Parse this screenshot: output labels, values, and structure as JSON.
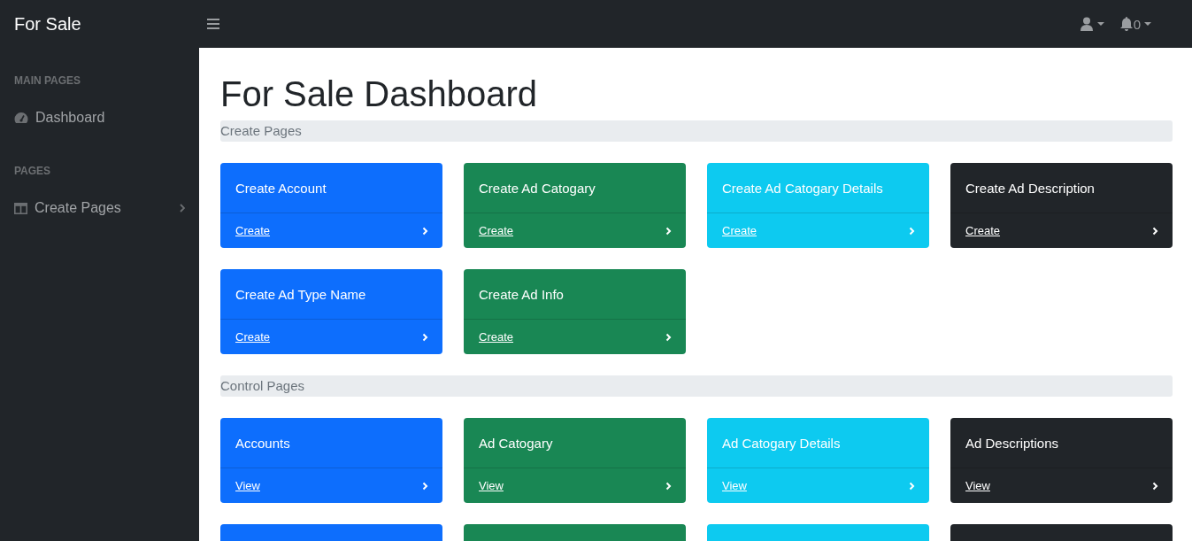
{
  "topbar": {
    "brand": "For Sale",
    "notification_count": "0"
  },
  "sidebar": {
    "sections": [
      {
        "heading": "MAIN PAGES",
        "items": [
          {
            "label": "Dashboard",
            "kind": "gauge",
            "expandable": false
          }
        ]
      },
      {
        "heading": "PAGES",
        "items": [
          {
            "label": "Create Pages",
            "kind": "columns",
            "expandable": true
          }
        ]
      }
    ]
  },
  "main": {
    "title": "For Sale Dashboard",
    "sections": [
      {
        "heading": "Create Pages",
        "cards": [
          {
            "title": "Create Account",
            "link": "Create",
            "color": "#0d6efd"
          },
          {
            "title": "Create Ad Catogary",
            "link": "Create",
            "color": "#198754"
          },
          {
            "title": "Create Ad Catogary Details",
            "link": "Create",
            "color": "#0dcaf0"
          },
          {
            "title": "Create Ad Description",
            "link": "Create",
            "color": "#212529"
          },
          {
            "title": "Create Ad Type Name",
            "link": "Create",
            "color": "#0d6efd"
          },
          {
            "title": "Create Ad Info",
            "link": "Create",
            "color": "#198754"
          }
        ]
      },
      {
        "heading": "Control Pages",
        "cards": [
          {
            "title": "Accounts",
            "link": "View",
            "color": "#0d6efd"
          },
          {
            "title": "Ad Catogary",
            "link": "View",
            "color": "#198754"
          },
          {
            "title": "Ad Catogary Details",
            "link": "View",
            "color": "#0dcaf0"
          },
          {
            "title": "Ad Descriptions",
            "link": "View",
            "color": "#212529"
          },
          {
            "color": "#0d6efd"
          },
          {
            "color": "#198754"
          },
          {
            "color": "#0dcaf0"
          },
          {
            "color": "#212529"
          }
        ]
      }
    ]
  }
}
